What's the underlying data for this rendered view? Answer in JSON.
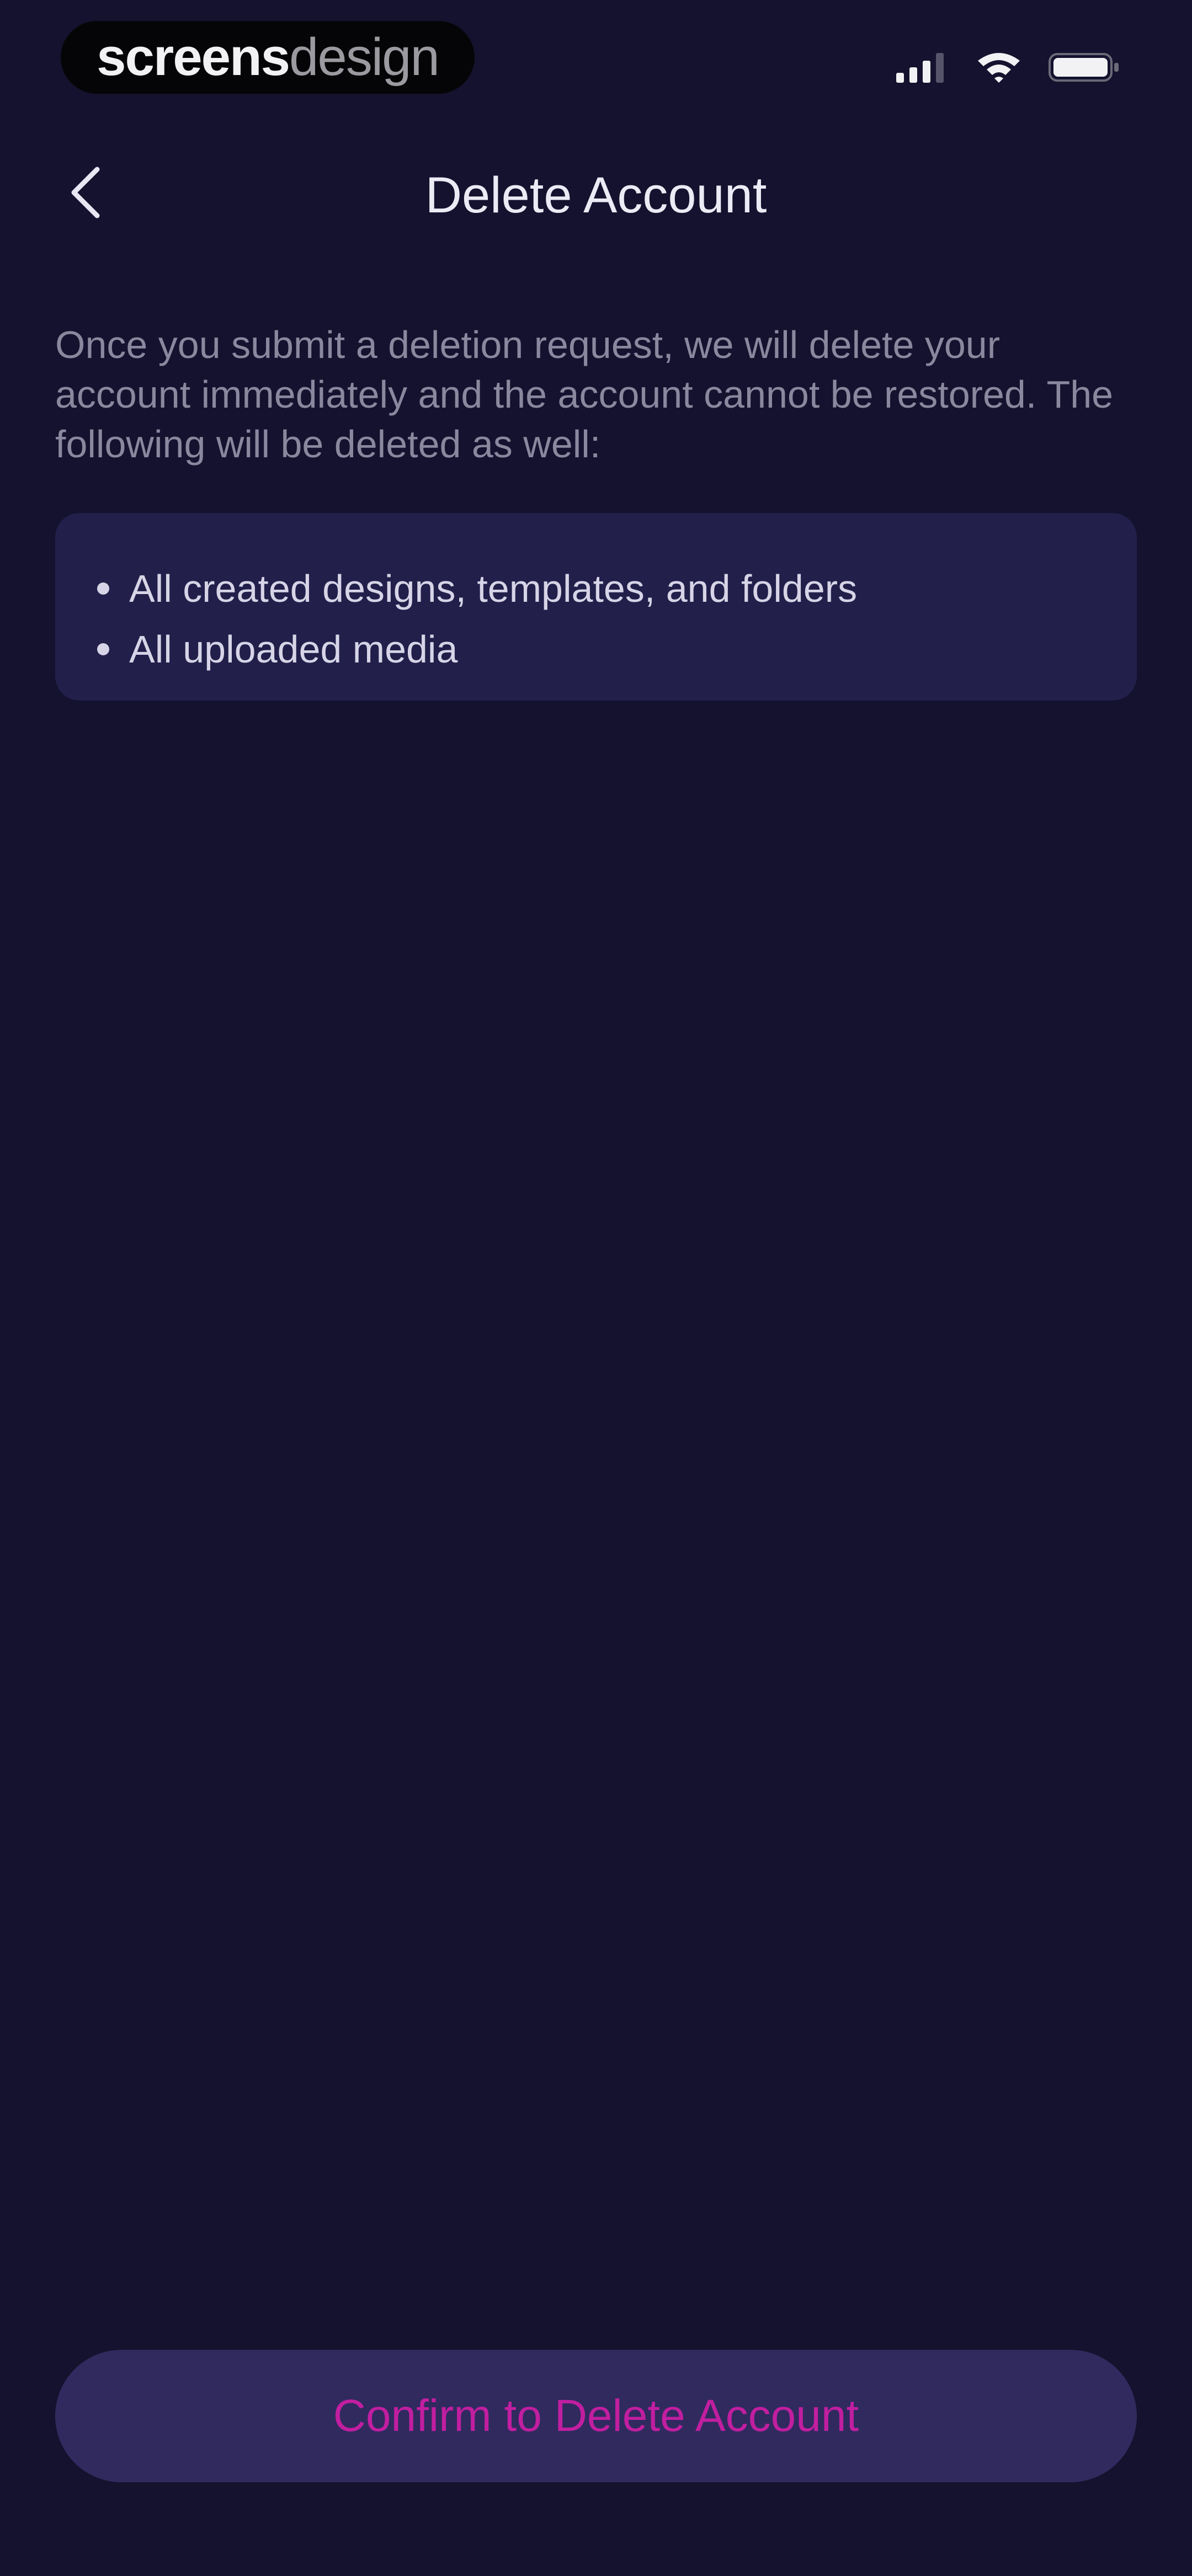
{
  "status_bar": {
    "brand_strong": "screens",
    "brand_light": "design",
    "icons": [
      "cellular-signal-icon",
      "wifi-icon",
      "battery-icon"
    ]
  },
  "nav": {
    "back_icon": "chevron-left-icon",
    "title": "Delete Account"
  },
  "description": "Once you submit a deletion request, we will delete your account immediately and the account cannot be restored. The following will be deleted as well:",
  "deleted_items": [
    "All created designs, templates, and folders",
    "All uploaded media"
  ],
  "confirm_button": {
    "label": "Confirm to Delete Account"
  },
  "colors": {
    "background": "#14122e",
    "card": "#221f4b",
    "button_background": "#302a5f",
    "button_text": "#c11ea0",
    "secondary_text": "#8a879e"
  }
}
